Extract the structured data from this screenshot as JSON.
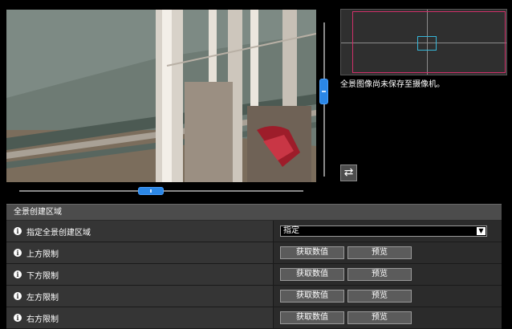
{
  "panorama": {
    "status_message": "全景图像尚未保存至摄像机。"
  },
  "icons": {
    "swap": "swap-arrows-icon",
    "info": "info-icon",
    "dropdown": "chevron-down-icon"
  },
  "colors": {
    "slider_knob": "#2b87e6",
    "panorama_range": "#d0306a",
    "camera_frame": "#36b6d8"
  },
  "settings": {
    "section_title": "全景创建区域",
    "specify_area": {
      "label": "指定全景创建区域",
      "selected_value": "指定"
    },
    "rows": [
      {
        "label": "上方限制",
        "get_value_button": "获取数值",
        "preview_button": "预览"
      },
      {
        "label": "下方限制",
        "get_value_button": "获取数值",
        "preview_button": "预览"
      },
      {
        "label": "左方限制",
        "get_value_button": "获取数值",
        "preview_button": "预览"
      },
      {
        "label": "右方限制",
        "get_value_button": "获取数值",
        "preview_button": "预览"
      }
    ]
  }
}
